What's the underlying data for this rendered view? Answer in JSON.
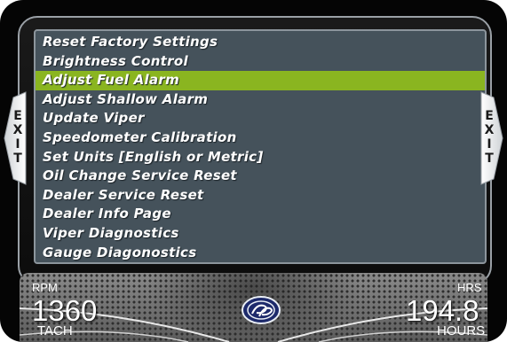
{
  "menu": {
    "items": [
      {
        "label": "Reset Factory Settings"
      },
      {
        "label": "Brightness Control"
      },
      {
        "label": "Adjust Fuel Alarm",
        "selected": true
      },
      {
        "label": "Adjust Shallow Alarm"
      },
      {
        "label": "Update Viper"
      },
      {
        "label": "Speedometer Calibration"
      },
      {
        "label": "Set Units [English or Metric]"
      },
      {
        "label": "Oil Change Service Reset"
      },
      {
        "label": "Dealer Service Reset"
      },
      {
        "label": "Dealer Info Page"
      },
      {
        "label": "Viper Diagnostics"
      },
      {
        "label": "Gauge Diagonostics"
      }
    ]
  },
  "exit_left": {
    "letters": [
      "E",
      "X",
      "I",
      "T"
    ]
  },
  "exit_right": {
    "letters": [
      "E",
      "X",
      "I",
      "T"
    ]
  },
  "gauges": {
    "rpm_label": "RPM",
    "tach_value": "1360",
    "tach_label": "TACH",
    "hrs_label": "HRS",
    "hours_value": "194.8",
    "hours_label": "HOURS"
  },
  "colors": {
    "panel": "#45525b",
    "selected": "#8ab520",
    "text": "#ffffff"
  },
  "icons": {
    "logo": "pp-brand-logo",
    "exit": "exit-tab"
  }
}
